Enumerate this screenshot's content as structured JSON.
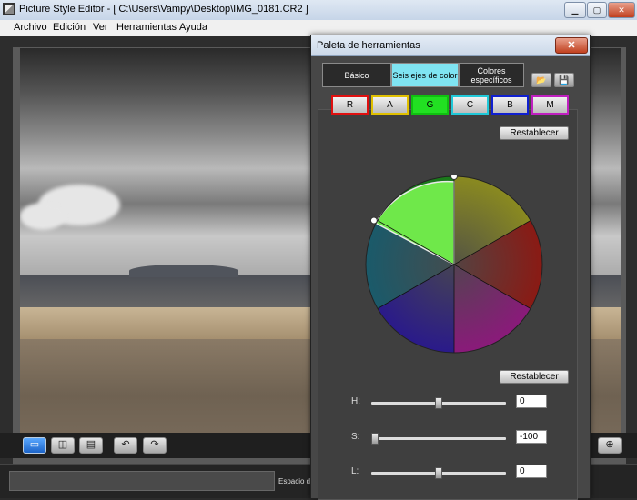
{
  "window": {
    "title": "Picture Style Editor - [ C:\\Users\\Vampy\\Desktop\\IMG_0181.CR2 ]",
    "minimize_icon": "minimize-icon",
    "maximize_icon": "maximize-icon",
    "close_icon": "close-icon"
  },
  "menu": [
    "Archivo",
    "Edición",
    "Ver",
    "Herramientas",
    "Ayuda"
  ],
  "status_bar": {
    "text": "Espacio de c"
  },
  "palette": {
    "title": "Paleta de herramientas",
    "close_label": "✕",
    "tabs": [
      {
        "label": "Básico",
        "active": false
      },
      {
        "label": "Seis ejes de color",
        "active": true
      },
      {
        "label": "Colores específicos",
        "active": false
      }
    ],
    "color_buttons": [
      {
        "label": "R",
        "color": "#e01010",
        "selected": false
      },
      {
        "label": "A",
        "color": "#e0c000",
        "selected": false
      },
      {
        "label": "G",
        "color": "#10c010",
        "selected": true
      },
      {
        "label": "C",
        "color": "#20c8d8",
        "selected": false
      },
      {
        "label": "B",
        "color": "#1020d0",
        "selected": false
      },
      {
        "label": "M",
        "color": "#c020c0",
        "selected": false
      }
    ],
    "reset_label_top": "Restablecer",
    "reset_label_bottom": "Restablecer",
    "sliders": [
      {
        "label": "H:",
        "value": "0",
        "fraction": 0.5
      },
      {
        "label": "S:",
        "value": "-100",
        "fraction": 0.0
      },
      {
        "label": "L:",
        "value": "0",
        "fraction": 0.5
      }
    ]
  }
}
